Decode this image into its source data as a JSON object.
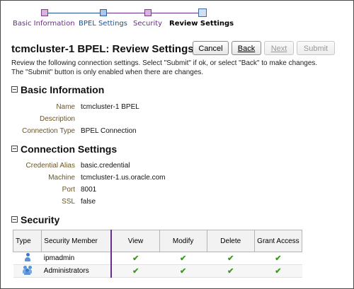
{
  "train": {
    "stops": [
      {
        "label": "Basic Information",
        "state": "visited"
      },
      {
        "label": "BPEL Settings",
        "state": "next"
      },
      {
        "label": "Security",
        "state": "visited"
      },
      {
        "label": "Review Settings",
        "state": "current"
      }
    ]
  },
  "header": {
    "title": "tcmcluster-1 BPEL: Review Settings",
    "buttons": {
      "cancel": "Cancel",
      "back": "Back",
      "next": "Next",
      "submit": "Submit"
    }
  },
  "instructions": {
    "line1": "Review the following connection settings. Select \"Submit\" if ok, or select \"Back\" to make changes.",
    "line2": "The \"Submit\" button is only enabled when there are changes."
  },
  "basic_info": {
    "heading": "Basic Information",
    "fields": [
      {
        "label": "Name",
        "value": "tcmcluster-1 BPEL"
      },
      {
        "label": "Description",
        "value": ""
      },
      {
        "label": "Connection Type",
        "value": "BPEL Connection"
      }
    ]
  },
  "connection_settings": {
    "heading": "Connection Settings",
    "fields": [
      {
        "label": "Credential Alias",
        "value": "basic.credential"
      },
      {
        "label": "Machine",
        "value": "tcmcluster-1.us.oracle.com"
      },
      {
        "label": "Port",
        "value": "8001"
      },
      {
        "label": "SSL",
        "value": "false"
      }
    ]
  },
  "security": {
    "heading": "Security",
    "columns": [
      "Type",
      "Security Member",
      "View",
      "Modify",
      "Delete",
      "Grant Access"
    ],
    "rows": [
      {
        "type_icon": "user-icon",
        "member": "ipmadmin",
        "view": "✔",
        "modify": "✔",
        "delete": "✔",
        "grant": "✔"
      },
      {
        "type_icon": "group-icon",
        "member": "Administrators",
        "view": "✔",
        "modify": "✔",
        "delete": "✔",
        "grant": "✔"
      }
    ]
  },
  "colors": {
    "visited": "#6a2b8c",
    "next": "#1f4e8c",
    "label": "#6b5520",
    "check": "#3a9a1a"
  }
}
